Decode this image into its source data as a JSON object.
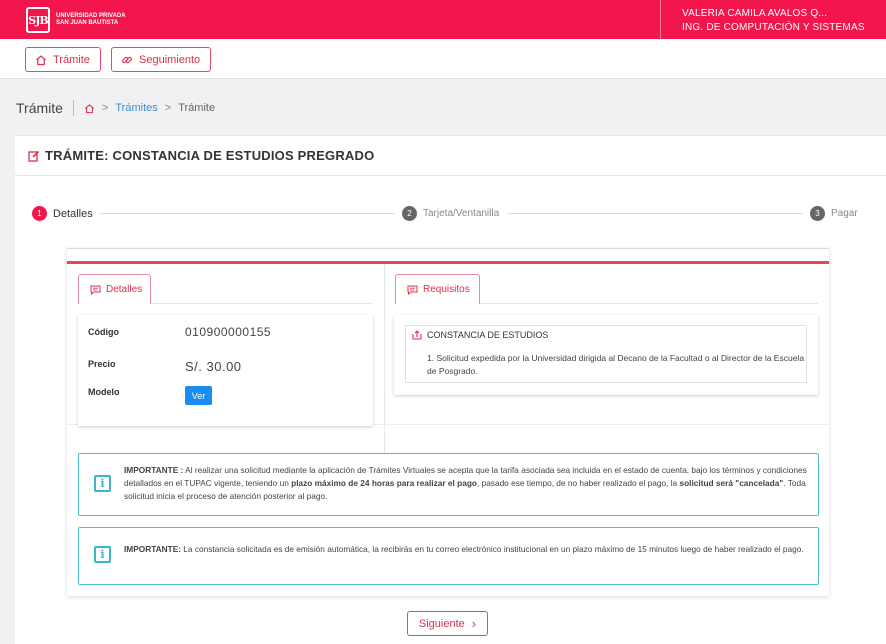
{
  "header": {
    "brand_line1": "Universidad Privada",
    "brand_line2": "San Juan Bautista",
    "logo_letters": "SJB",
    "user_name": "VALERIA CAMILA AVALOS Q...",
    "user_program": "ING. DE COMPUTACIÓN Y SISTEMAS",
    "brand_color": "#f2164c"
  },
  "nav": {
    "tramite_label": "Trámite",
    "seguimiento_label": "Seguimiento"
  },
  "breadcrumb": {
    "title": "Trámite",
    "sep": ">",
    "link": "Trámites",
    "current": "Trámite"
  },
  "card": {
    "title": "TRÁMITE: CONSTANCIA DE ESTUDIOS PREGRADO"
  },
  "steps": [
    {
      "num": "1",
      "label": "Detalles",
      "active": true
    },
    {
      "num": "2",
      "label": "Tarjeta/Ventanilla",
      "active": false
    },
    {
      "num": "3",
      "label": "Pagar",
      "active": false
    }
  ],
  "details": {
    "tab_label": "Detalles",
    "codigo_label": "Código",
    "codigo_value": "010900000155",
    "precio_label": "Precio",
    "precio_value": "S/. 30.00",
    "modelo_label": "Modelo",
    "ver_label": "Ver"
  },
  "requisitos": {
    "tab_label": "Requisitos",
    "title": "CONSTANCIA DE ESTUDIOS",
    "item": "1. Solicitud expedida por la Universidad dirigida al Decano de la Facultad o al Director de la Escuela de Posgrado."
  },
  "alerts": {
    "a1_strong": "IMPORTANTE :",
    "a1_part1": " Al realizar una solicitud mediante la aplicación de Trámites Virtuales se acepta que la tarifa asociada sea incluida en el estado de cuenta, bajo los términos y condiciones detallados en el TUPAC vigente, teniendo un ",
    "a1_bold2": "plazo máximo de 24 horas para realizar el pago",
    "a1_part2": ", pasado ese tiempo, de no haber realizado el pago, la ",
    "a1_bold3": "solicitud será \"cancelada\"",
    "a1_part3": ". Toda solicitud inicia el proceso de atención posterior al pago.",
    "a2_strong": "IMPORTANTE:",
    "a2_text": " La constancia solicitada es de emisión automática, la recibirás en tu correo electrónico institucional en un plazo máximo de 15 minutos luego de haber realizado el pago."
  },
  "footer": {
    "next_label": "Siguiente",
    "next_arrow": "›"
  }
}
